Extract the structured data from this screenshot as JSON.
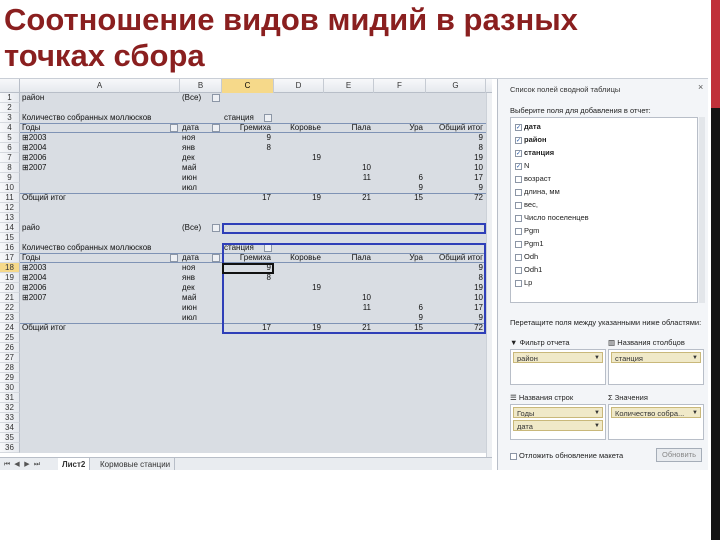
{
  "title": {
    "line1": "Соотношение видов мидий в разных",
    "line2": "точках сбора"
  },
  "spreadsheet": {
    "columns": [
      "A",
      "B",
      "C",
      "D",
      "E",
      "F",
      "G"
    ],
    "rows": [
      "1",
      "2",
      "3",
      "4",
      "5",
      "6",
      "7",
      "8",
      "9",
      "10",
      "11",
      "12",
      "13",
      "14",
      "15",
      "16",
      "17",
      "18",
      "19",
      "20",
      "21",
      "22",
      "23",
      "24",
      "25",
      "26",
      "27",
      "28",
      "29",
      "30",
      "31",
      "32",
      "33",
      "34",
      "35",
      "36"
    ],
    "selected_column": "C",
    "selected_row": "18",
    "pivot1": {
      "filter_label": "район",
      "filter_value": "(Все)",
      "count_label": "Количество собранных моллюсков",
      "col_field": "станция",
      "header": [
        "Годы",
        "дата",
        "Гремиха",
        "Коровье",
        "Пала",
        "Ура",
        "Общий итог"
      ],
      "rows": [
        [
          "⊞2003",
          "ноя",
          "9",
          "",
          "",
          "",
          "9"
        ],
        [
          "⊞2004",
          "янв",
          "8",
          "",
          "",
          "",
          "8"
        ],
        [
          "⊞2006",
          "дек",
          "",
          "19",
          "",
          "",
          "19"
        ],
        [
          "⊞2007",
          "май",
          "",
          "",
          "10",
          "",
          "10"
        ],
        [
          "",
          "июн",
          "",
          "",
          "11",
          "6",
          "17"
        ],
        [
          "",
          "июл",
          "",
          "",
          "",
          "9",
          "9"
        ]
      ],
      "total": [
        "Общий итог",
        "",
        "17",
        "19",
        "21",
        "15",
        "72"
      ]
    },
    "pivot2": {
      "filter_label": "райо",
      "filter_value": "(Все)",
      "count_label": "Количество собранных моллюсков",
      "col_field": "станция",
      "header": [
        "Годы",
        "дата",
        "Гремиха",
        "Коровье",
        "Пала",
        "Ура",
        "Общий итог"
      ],
      "rows": [
        [
          "⊞2003",
          "ноя",
          "9",
          "",
          "",
          "",
          "9"
        ],
        [
          "⊞2004",
          "янв",
          "8",
          "",
          "",
          "",
          "8"
        ],
        [
          "⊞2006",
          "дек",
          "",
          "19",
          "",
          "",
          "19"
        ],
        [
          "⊞2007",
          "май",
          "",
          "",
          "10",
          "",
          "10"
        ],
        [
          "",
          "июн",
          "",
          "",
          "11",
          "6",
          "17"
        ],
        [
          "",
          "июл",
          "",
          "",
          "",
          "9",
          "9"
        ]
      ],
      "total": [
        "Общий итог",
        "",
        "17",
        "19",
        "21",
        "15",
        "72"
      ]
    },
    "tabs": [
      "Лист2",
      "Кормовые станции"
    ]
  },
  "pivot_panel": {
    "title": "Список полей сводной таблицы",
    "close": "×",
    "choose_label": "Выберите поля для добавления в отчет:",
    "fields": [
      {
        "label": "дата",
        "checked": true,
        "bold": true
      },
      {
        "label": "район",
        "checked": true,
        "bold": true
      },
      {
        "label": "станция",
        "checked": true,
        "bold": true
      },
      {
        "label": "N",
        "checked": true,
        "bold": false
      },
      {
        "label": "возраст",
        "checked": false,
        "bold": false
      },
      {
        "label": "длина, мм",
        "checked": false,
        "bold": false
      },
      {
        "label": "вес,",
        "checked": false,
        "bold": false
      },
      {
        "label": "Число поселенцев",
        "checked": false,
        "bold": false
      },
      {
        "label": "Pgm",
        "checked": false,
        "bold": false
      },
      {
        "label": "Pgm1",
        "checked": false,
        "bold": false
      },
      {
        "label": "Odh",
        "checked": false,
        "bold": false
      },
      {
        "label": "Odh1",
        "checked": false,
        "bold": false
      },
      {
        "label": "Lp",
        "checked": false,
        "bold": false
      }
    ],
    "drag_label": "Перетащите поля между указанными ниже областями:",
    "zone_filter": "Фильтр отчета",
    "zone_columns": "Названия столбцов",
    "zone_rows": "Названия строк",
    "zone_values": "Значения",
    "chip_filter": "район",
    "chip_columns": "станция",
    "chip_rows_1": "Годы",
    "chip_rows_2": "дата",
    "chip_values": "Количество собра...",
    "defer_label": "Отложить обновление макета",
    "update_button": "Обновить"
  }
}
